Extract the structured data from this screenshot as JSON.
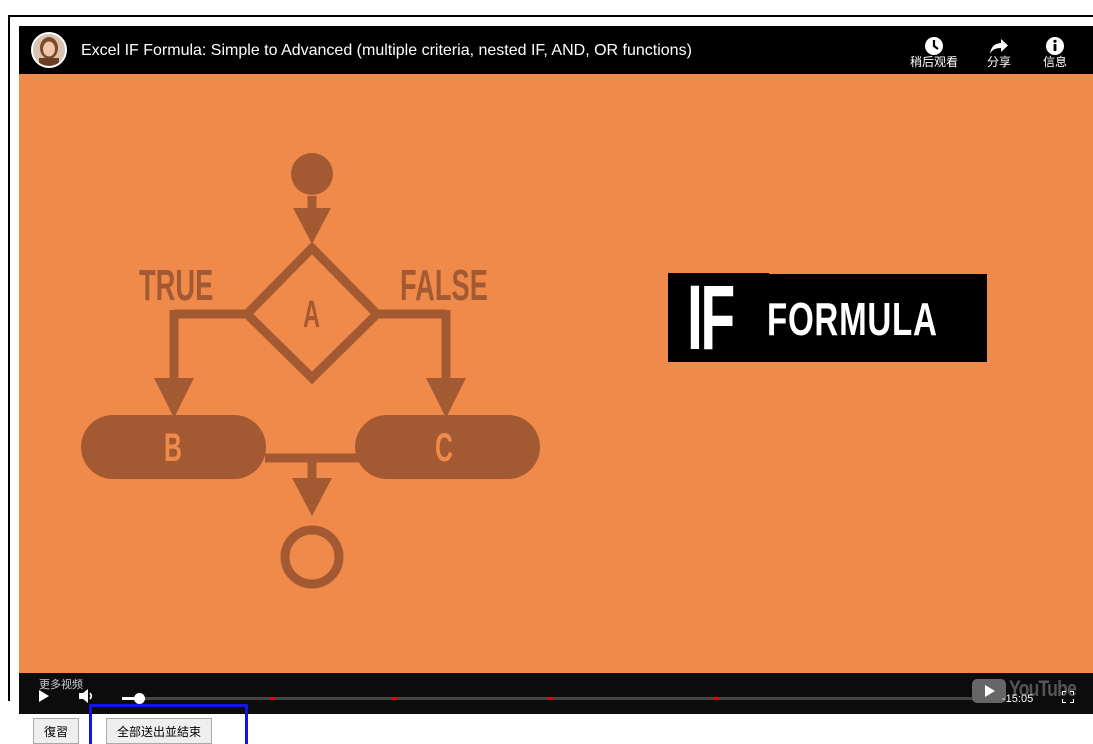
{
  "video": {
    "title": "Excel IF Formula: Simple to Advanced (multiple criteria, nested IF, AND, OR functions)",
    "actions": [
      {
        "label": "稍后观看",
        "icon": "clock-icon"
      },
      {
        "label": "分享",
        "icon": "share-arrow-icon"
      },
      {
        "label": "信息",
        "icon": "info-icon"
      }
    ],
    "thumbnail": {
      "background_color": "#ef8a4a",
      "flow_color": "#a35a33",
      "true_label": "TRUE",
      "false_label": "FALSE",
      "node_a": "A",
      "node_b": "B",
      "node_c": "C",
      "title_big": "IF",
      "title_small": "FORMULA"
    }
  },
  "player": {
    "more_videos_label": "更多视频",
    "time_remaining": "-15:05",
    "progress_fraction": 0.02,
    "chapter_marks": [
      0.17,
      0.31,
      0.49,
      0.68
    ],
    "logo_text": "YouTube"
  },
  "buttons": {
    "review_label": "復習",
    "submit_all_label": "全部送出並結束"
  },
  "colors": {
    "highlight_border": "#1515e0"
  }
}
